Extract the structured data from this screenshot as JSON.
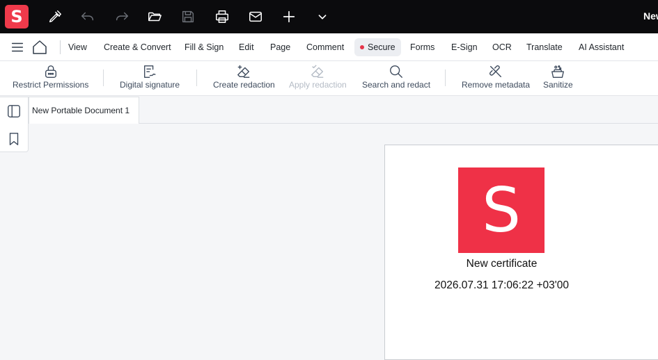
{
  "app": {
    "logo_letter": "S",
    "window_title": "New",
    "accent": "#ef3a4b"
  },
  "toolbar": {
    "icons": [
      "sign-pen-icon",
      "undo-icon",
      "redo-icon",
      "open-folder-icon",
      "save-icon",
      "print-icon",
      "mail-icon",
      "new-plus-icon",
      "chevron-down-icon"
    ]
  },
  "menu": {
    "items": [
      "View",
      "Create & Convert",
      "Fill & Sign",
      "Edit",
      "Page",
      "Comment",
      "Secure",
      "Forms",
      "E-Sign",
      "OCR",
      "Translate",
      "AI Assistant"
    ],
    "active": "Secure"
  },
  "ribbon": {
    "buttons": [
      {
        "label": "Restrict Permissions",
        "icon": "lock-icon",
        "enabled": true
      },
      {
        "label": "Digital signature",
        "icon": "signature-icon",
        "enabled": true
      },
      {
        "label": "Create redaction",
        "icon": "eraser-plus-icon",
        "enabled": true
      },
      {
        "label": "Apply redaction",
        "icon": "eraser-check-icon",
        "enabled": false
      },
      {
        "label": "Search and redact",
        "icon": "search-icon",
        "enabled": true
      },
      {
        "label": "Remove metadata",
        "icon": "unlink-icon",
        "enabled": true
      },
      {
        "label": "Sanitize",
        "icon": "sanitize-bucket-icon",
        "enabled": true
      }
    ]
  },
  "tabs": [
    {
      "label": "New Portable Document 1"
    }
  ],
  "document": {
    "logo_letter": "S",
    "title": "New certificate",
    "date": "2026.07.31 17:06:22 +03'00"
  }
}
